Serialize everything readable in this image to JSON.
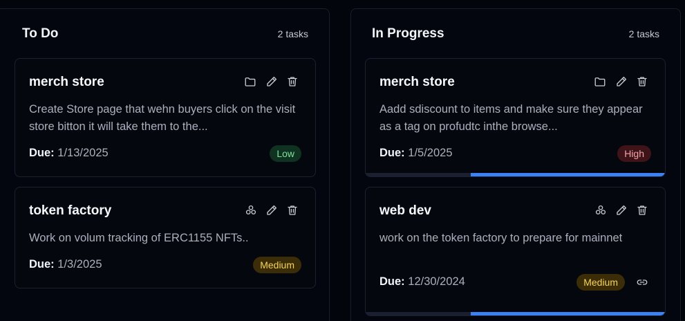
{
  "columns": [
    {
      "title": "To Do",
      "count": "2 tasks",
      "cards": [
        {
          "title": "merch store",
          "description": "Create Store page that wehn buyers click on the visit store bitton it will take them to the...",
          "due_label": "Due:",
          "due_date": "1/13/2025",
          "priority": "Low",
          "type_icon": "folder-icon"
        },
        {
          "title": "token factory",
          "description": "Work on volum tracking of ERC1155 NFTs..",
          "due_label": "Due:",
          "due_date": "1/3/2025",
          "priority": "Medium",
          "type_icon": "cluster-icon"
        }
      ]
    },
    {
      "title": "In Progress",
      "count": "2 tasks",
      "cards": [
        {
          "title": "merch store",
          "description": "Aadd sdiscount to items and make sure they appear as a tag on profudtc inthe browse...",
          "due_label": "Due:",
          "due_date": "1/5/2025",
          "priority": "High",
          "type_icon": "folder-icon",
          "progress": 0.65
        },
        {
          "title": "web dev",
          "description": "work on the token factory to prepare for mainnet",
          "due_label": "Due:",
          "due_date": "12/30/2024",
          "priority": "Medium",
          "type_icon": "cluster-icon",
          "has_link": true,
          "progress": 0.65
        }
      ]
    }
  ],
  "colors": {
    "background": "#03050d",
    "card_border": "#1c2130",
    "progress": "#3b82f6",
    "low": "#7ee19e",
    "medium": "#f7d356",
    "high": "#f2a3a8"
  }
}
